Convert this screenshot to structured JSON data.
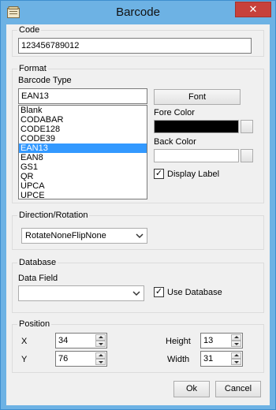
{
  "window": {
    "title": "Barcode",
    "close_glyph": "✕",
    "app_icon": "barcode-app-icon"
  },
  "code": {
    "group_label": "Code",
    "value": "123456789012"
  },
  "format": {
    "group_label": "Format",
    "barcode_type_label": "Barcode Type",
    "barcode_type_value": "EAN13",
    "types": [
      "Blank",
      "CODABAR",
      "CODE128",
      "CODE39",
      "EAN13",
      "EAN8",
      "GS1",
      "QR",
      "UPCA",
      "UPCE"
    ],
    "selected_type": "EAN13",
    "font_button": "Font",
    "fore_color_label": "Fore Color",
    "fore_color": "#000000",
    "back_color_label": "Back Color",
    "back_color": "#ffffff",
    "display_label": "Display Label",
    "display_label_checked": true
  },
  "direction": {
    "group_label": "Direction/Rotation",
    "value": "RotateNoneFlipNone"
  },
  "database": {
    "group_label": "Database",
    "data_field_label": "Data Field",
    "data_field_value": "",
    "use_database_label": "Use Database",
    "use_database_checked": true
  },
  "position": {
    "group_label": "Position",
    "x_label": "X",
    "x_value": "34",
    "y_label": "Y",
    "y_value": "76",
    "height_label": "Height",
    "height_value": "13",
    "width_label": "Width",
    "width_value": "31"
  },
  "buttons": {
    "ok": "Ok",
    "cancel": "Cancel"
  },
  "colors": {
    "titlebar": "#6db2e4",
    "close": "#c7413b",
    "selection": "#3399ff"
  }
}
